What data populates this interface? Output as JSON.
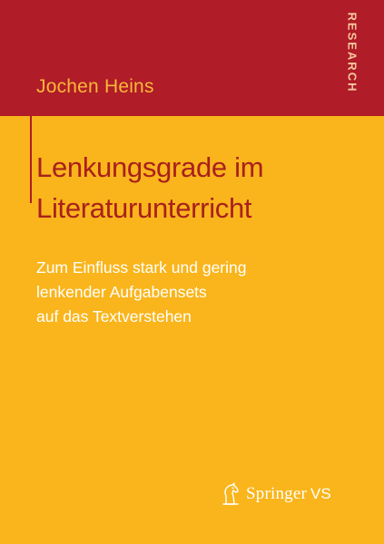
{
  "cover": {
    "author": "Jochen Heins",
    "series_label": "RESEARCH",
    "title_lines": [
      "Lenkungsgrade im",
      "Literaturunterricht"
    ],
    "subtitle_lines": [
      "Zum Einfluss stark und gering",
      "lenkender Aufgabensets",
      "auf das Textverstehen"
    ],
    "publisher": {
      "name": "Springer",
      "suffix": "VS",
      "logo_icon": "springer-horse-logo-icon"
    }
  },
  "colors": {
    "band_red": "#b01c27",
    "background_yellow": "#f9b51b",
    "title_red": "#a9201e",
    "author_text": "#f8b83a",
    "subtitle_text": "#ffffff"
  }
}
